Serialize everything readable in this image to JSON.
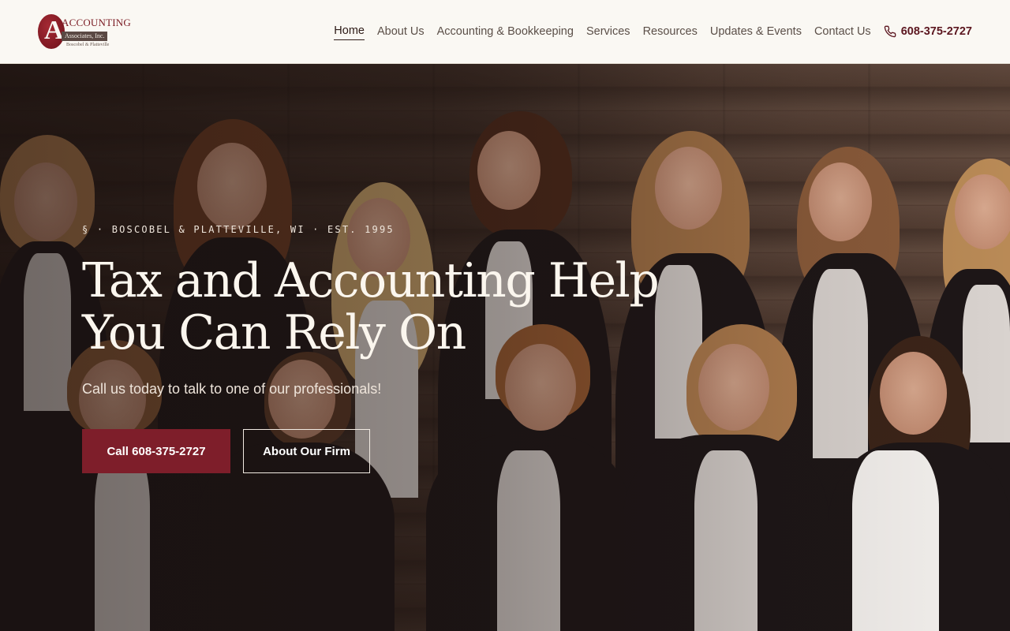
{
  "brand": {
    "logo_letter": "A",
    "logo_line1": "ACCOUNTING",
    "logo_line2": "Associates, Inc.",
    "logo_line3": "Boscobel & Platteville"
  },
  "nav": {
    "items": [
      {
        "label": "Home",
        "active": true
      },
      {
        "label": "About Us"
      },
      {
        "label": "Accounting & Bookkeeping"
      },
      {
        "label": "Services"
      },
      {
        "label": "Resources"
      },
      {
        "label": "Updates & Events"
      },
      {
        "label": "Contact Us"
      }
    ],
    "phone": "608-375-2727"
  },
  "hero": {
    "eyebrow": "§ · BOSCOBEL & PLATTEVILLE, WI · EST. 1995",
    "headline_line1": "Tax and Accounting Help",
    "headline_line2": "You Can Rely On",
    "subtext": "Call us today to talk to one of our professionals!",
    "primary_cta": "Call 608-375-2727",
    "secondary_cta": "About Our Firm"
  },
  "colors": {
    "header_bg": "#faf8f3",
    "accent": "#7e1e2a",
    "phone_text": "#5c1720"
  }
}
